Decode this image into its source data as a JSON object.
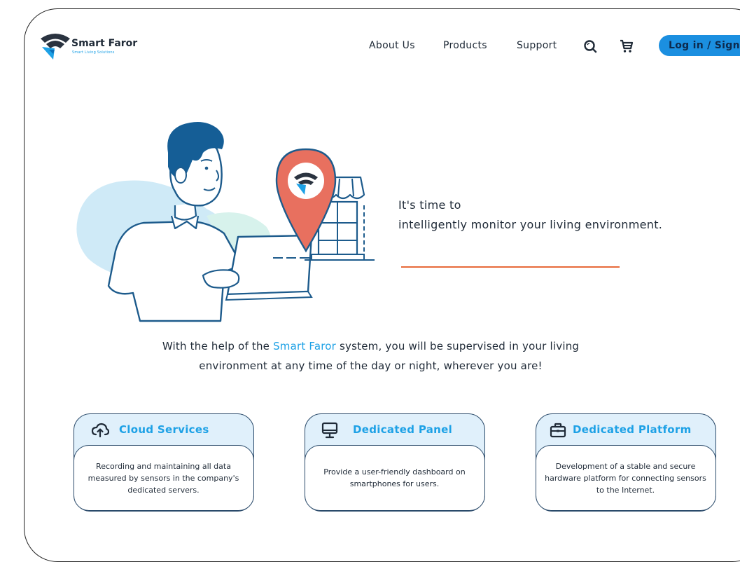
{
  "brand": {
    "name": "Smart Faror",
    "tagline": "Smart Living Solutions"
  },
  "nav": {
    "items": [
      "About Us",
      "Products",
      "Support"
    ],
    "login_label": "Log in / Sign"
  },
  "icons": {
    "search": "search-icon",
    "cart": "cart-icon"
  },
  "hero": {
    "line1": "It's time to",
    "line2": "intelligently monitor your living environment."
  },
  "description": {
    "part1": "With the help of the ",
    "brand": "Smart Faror",
    "part2": " system, you will be supervised in your living",
    "line2": "environment at any time of the day or night, wherever you are!"
  },
  "cards": [
    {
      "title": "Cloud Services",
      "icon": "cloud-upload-icon",
      "text": "Recording and maintaining all data measured by sensors in the company's dedicated servers."
    },
    {
      "title": "Dedicated Panel",
      "icon": "monitor-icon",
      "text": "Provide a user-friendly dashboard on smartphones for users."
    },
    {
      "title": "Dedicated Platform",
      "icon": "briefcase-icon",
      "text": "Development of a stable and secure hardware platform for connecting sensors to the Internet."
    }
  ],
  "colors": {
    "accent": "#1da1e6",
    "button": "#1b8fe0",
    "rule": "#e86a3a",
    "pin": "#e8705f",
    "card_head": "#e0f0fb",
    "dark": "#1f2a37"
  }
}
